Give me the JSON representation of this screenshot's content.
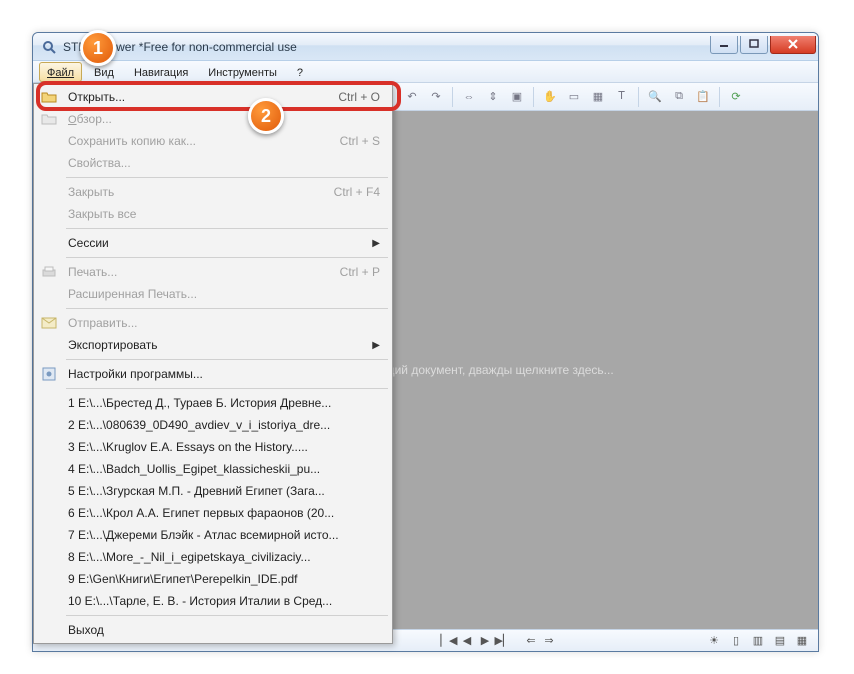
{
  "window": {
    "title": "STDU Viewer *Free for non-commercial use"
  },
  "menubar": {
    "file": "Файл",
    "view": "Вид",
    "navigation": "Навигация",
    "tools": "Инструменты",
    "help": "?"
  },
  "content": {
    "hint": "Чтобы открыть существующий документ, дважды щелкните здесь..."
  },
  "dropdown": {
    "open": {
      "label": "Открыть...",
      "shortcut": "Ctrl + O"
    },
    "browse": {
      "label": "Обзор..."
    },
    "save_copy": {
      "label": "Сохранить копию как...",
      "shortcut": "Ctrl + S"
    },
    "properties": {
      "label": "Свойства..."
    },
    "close": {
      "label": "Закрыть",
      "shortcut": "Ctrl + F4"
    },
    "close_all": {
      "label": "Закрыть все"
    },
    "sessions": {
      "label": "Сессии"
    },
    "print": {
      "label": "Печать...",
      "shortcut": "Ctrl + P"
    },
    "adv_print": {
      "label": "Расширенная Печать..."
    },
    "send": {
      "label": "Отправить..."
    },
    "export": {
      "label": "Экспортировать"
    },
    "settings": {
      "label": "Настройки программы..."
    },
    "recent": [
      "1 E:\\...\\Брестед Д., Тураев Б. История Древне...",
      "2 E:\\...\\080639_0D490_avdiev_v_i_istoriya_dre...",
      "3 E:\\...\\Kruglov E.A. Essays on the History.....",
      "4 E:\\...\\Badch_Uollis_Egipet_klassicheskii_pu...",
      "5 E:\\...\\Згурская М.П. - Древний Египет (Зага...",
      "6 E:\\...\\Крол А.А. Египет первых фараонов (20...",
      "7 E:\\...\\Джереми Блэйк - Атлас всемирной исто...",
      "8 E:\\...\\More_-_Nil_i_egipetskaya_civilizaciy...",
      "9 E:\\Gen\\Книги\\Египет\\Perepelkin_IDE.pdf",
      "10 E:\\...\\Тарле, Е. В. - История Италии в Сред..."
    ],
    "exit": {
      "label": "Выход"
    }
  },
  "callouts": {
    "one": "1",
    "two": "2"
  }
}
